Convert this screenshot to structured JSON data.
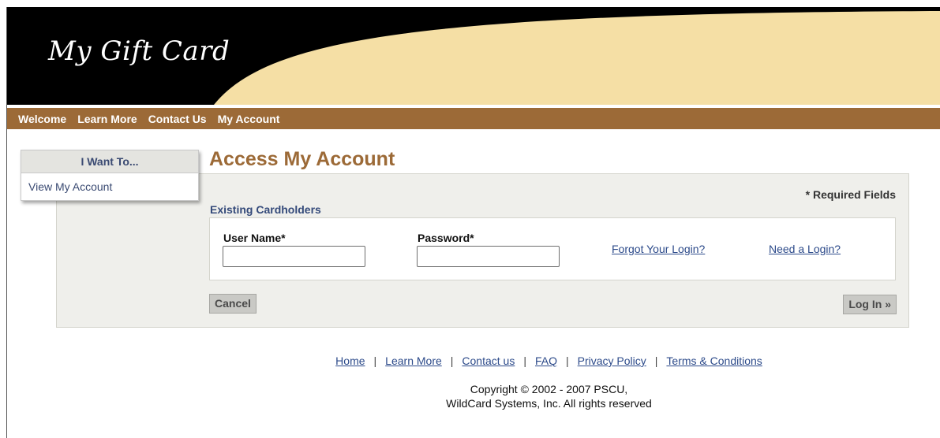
{
  "header": {
    "logo_text": "My Gift Card",
    "colors": {
      "banner": "#000000",
      "swoosh": "#f5dfa5",
      "nav": "#9c6a37"
    }
  },
  "nav": {
    "items": [
      {
        "label": "Welcome"
      },
      {
        "label": "Learn More"
      },
      {
        "label": "Contact Us"
      },
      {
        "label": "My Account"
      }
    ]
  },
  "sidebar": {
    "title": "I Want To...",
    "items": [
      {
        "label": "View My Account"
      }
    ]
  },
  "main": {
    "title": "Access My Account",
    "required_note": "* Required Fields",
    "section_label": "Existing Cardholders",
    "username": {
      "label": "User Name*",
      "value": "",
      "placeholder": ""
    },
    "password": {
      "label": "Password*",
      "value": "",
      "placeholder": ""
    },
    "forgot_link": "Forgot Your Login?",
    "need_link": "Need a Login?",
    "cancel_label": "Cancel",
    "login_label": "Log In »"
  },
  "footer": {
    "links": [
      {
        "label": "Home"
      },
      {
        "label": "Learn More"
      },
      {
        "label": "Contact us"
      },
      {
        "label": "FAQ"
      },
      {
        "label": "Privacy Policy"
      },
      {
        "label": "Terms & Conditions"
      }
    ],
    "copyright_line1": "Copyright © 2002 - 2007 PSCU,",
    "copyright_line2": "WildCard Systems, Inc. All rights reserved"
  }
}
